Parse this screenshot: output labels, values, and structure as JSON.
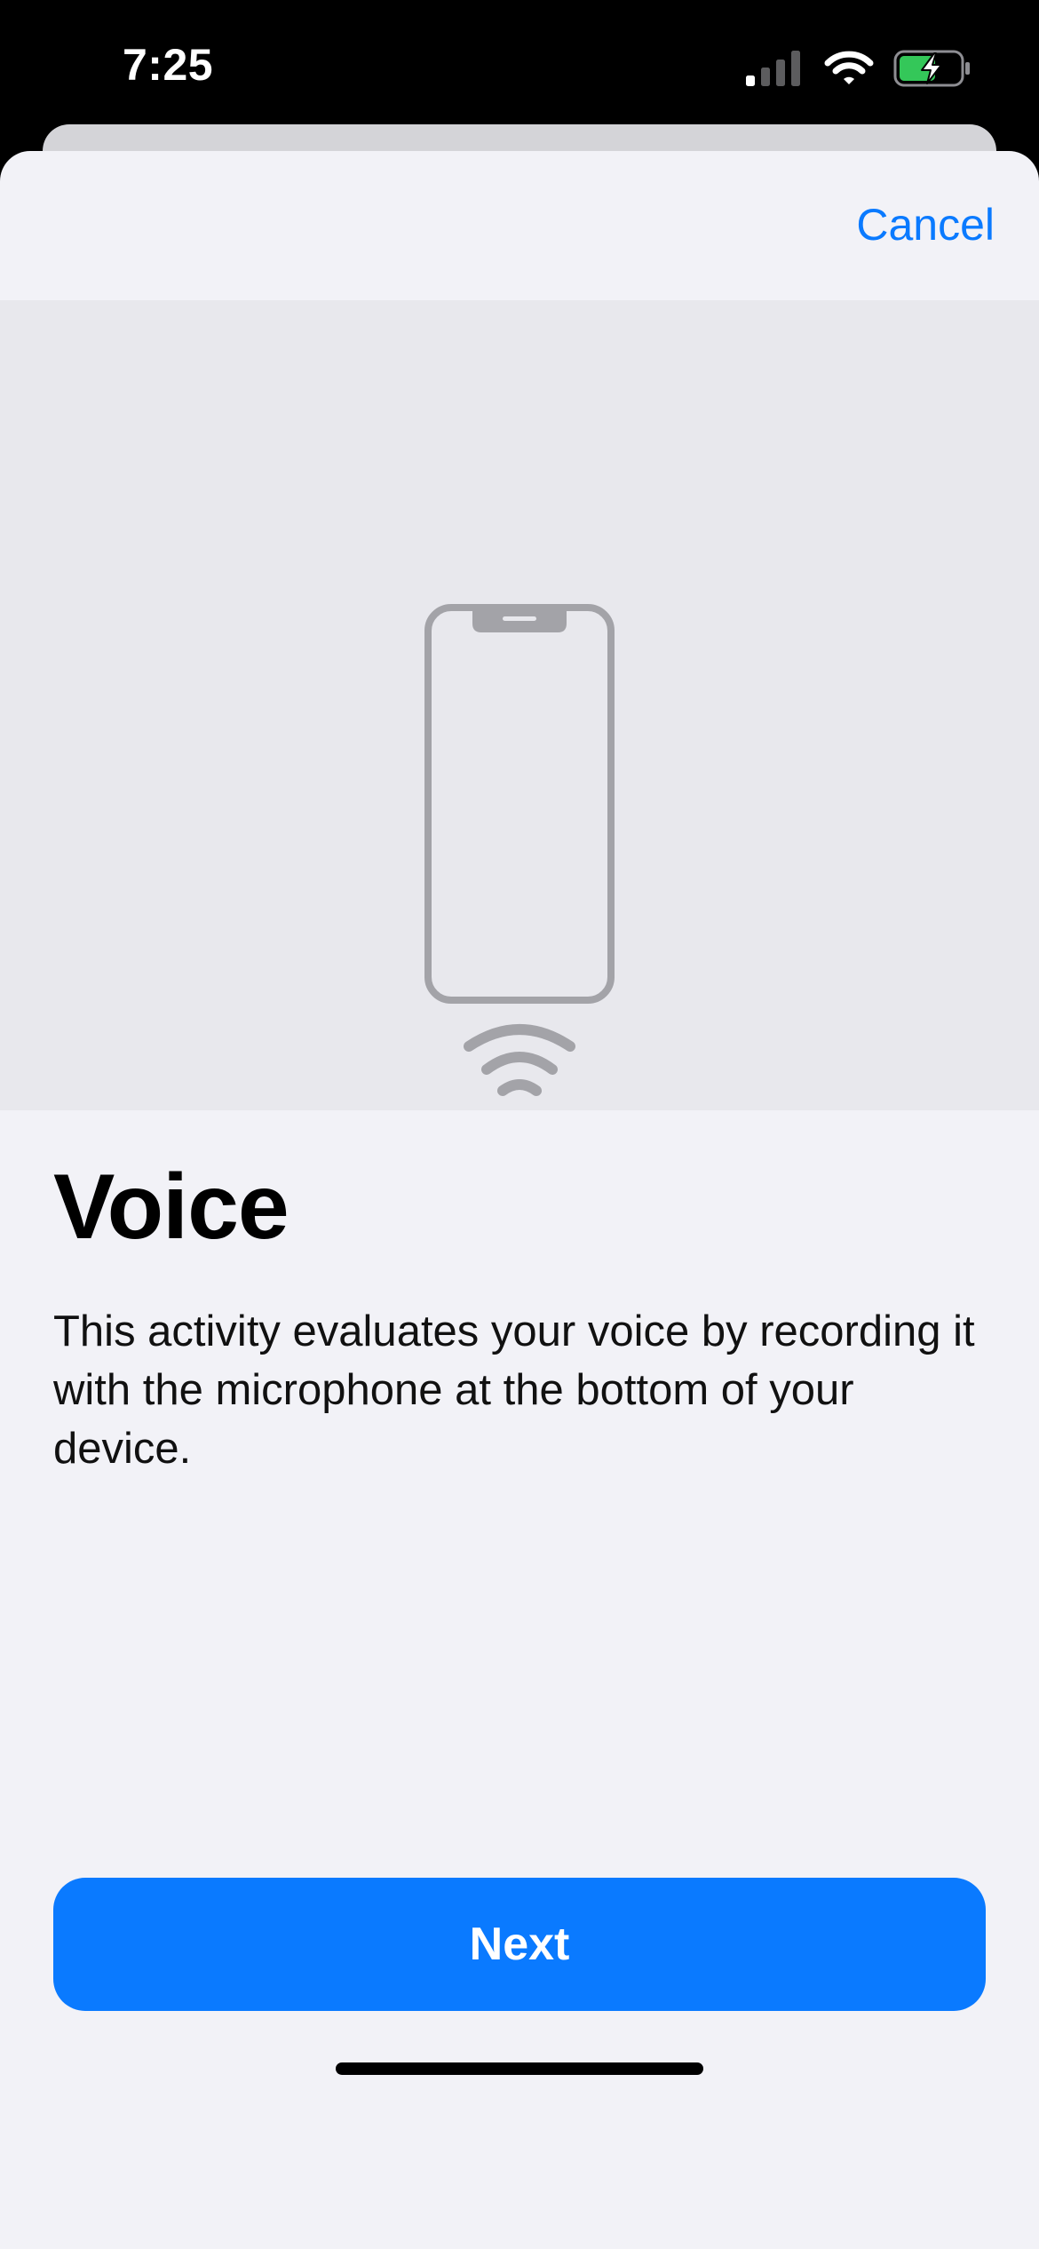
{
  "status_bar": {
    "time": "7:25",
    "icons": [
      "cellular-signal-icon",
      "wifi-icon",
      "battery-charging-icon"
    ]
  },
  "sheet": {
    "cancel_label": "Cancel",
    "illustration": [
      "iphone-outline-icon",
      "sound-waves-icon"
    ],
    "title": "Voice",
    "description": "This activity evaluates your voice by recording it with the microphone at the bottom of your device.",
    "next_label": "Next"
  },
  "colors": {
    "accent": "#0a7aff",
    "sheet_background": "#f2f2f7",
    "hero_background": "#e8e8ed",
    "illustration_gray": "#a3a3a8",
    "battery_green": "#34c759"
  }
}
